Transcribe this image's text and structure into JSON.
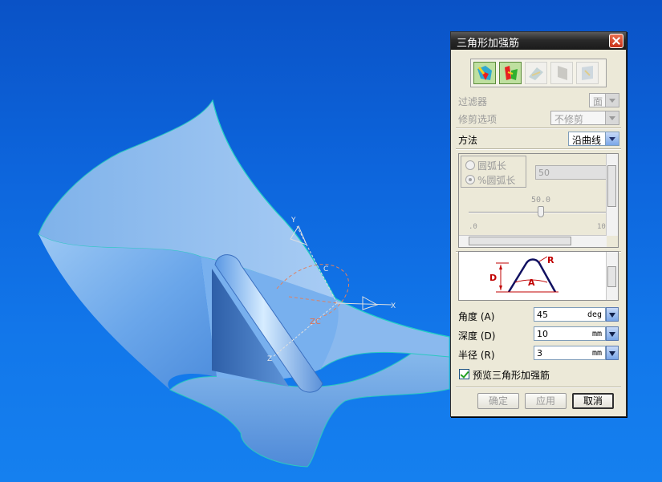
{
  "dialog": {
    "title": "三角形加强筋",
    "filter_label": "过滤器",
    "filter_value": "面",
    "trim_label": "修剪选项",
    "trim_value": "不修剪",
    "method_label": "方法",
    "method_value": "沿曲线",
    "arc_length_label": "圆弧长",
    "pct_arc_length_label": "%圆弧长",
    "arc_value": "50",
    "slider_value": "50.0",
    "slider_min": ".0",
    "slider_max": "10",
    "angle_label": "角度 (A)",
    "angle_value": "45",
    "angle_unit": "deg",
    "depth_label": "深度 (D)",
    "depth_value": "10",
    "depth_unit": "mm",
    "radius_label": "半径 (R)",
    "radius_value": "3",
    "radius_unit": "mm",
    "preview_label": "预览三角形加强筋",
    "preview_checked": true,
    "ok_label": "确定",
    "apply_label": "应用",
    "cancel_label": "取消",
    "diagram": {
      "r": "R",
      "d": "D",
      "a": "A"
    }
  },
  "viewport": {
    "axes": {
      "y": "Y",
      "x": "X",
      "z": "Z",
      "zc": "ZC",
      "c": "C"
    }
  },
  "colors": {
    "background": "#0d65dc",
    "surface": "#7ab4f0",
    "accent": "#cc2020"
  }
}
